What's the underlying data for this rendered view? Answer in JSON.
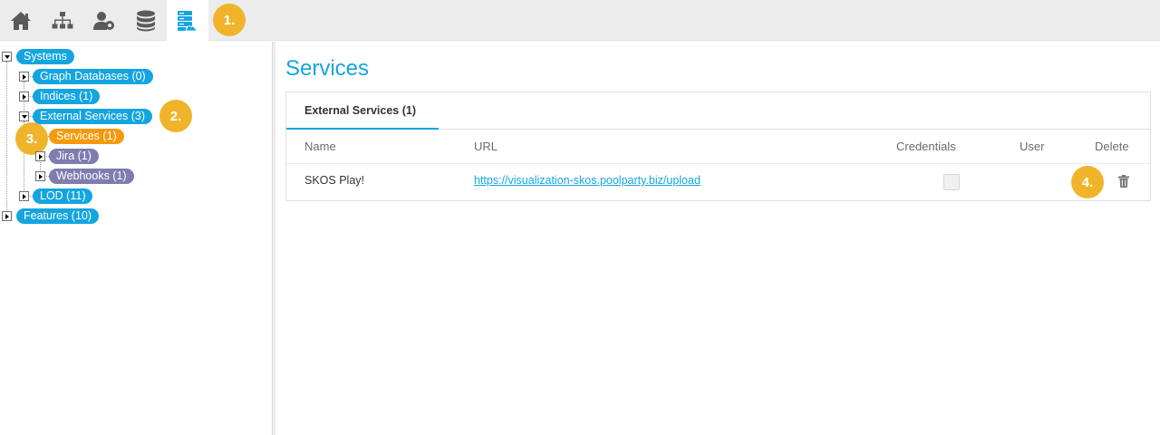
{
  "toolbar": {
    "buttons": [
      {
        "icon": "home-icon"
      },
      {
        "icon": "sitemap-icon"
      },
      {
        "icon": "user-settings-icon"
      },
      {
        "icon": "database-icon"
      },
      {
        "icon": "server-cloud-icon",
        "active": true
      }
    ]
  },
  "callouts": {
    "c1": "1.",
    "c2": "2.",
    "c3": "3.",
    "c4": "4."
  },
  "tree": {
    "systems": "Systems",
    "graph_databases": "Graph Databases (0)",
    "indices": "Indices (1)",
    "external_services": "External Services (3)",
    "services": "Services (1)",
    "jira": "Jira (1)",
    "webhooks": "Webhooks (1)",
    "lod": "LOD (11)",
    "features": "Features (10)"
  },
  "main": {
    "title": "Services",
    "tab_label": "External Services (1)",
    "columns": {
      "name": "Name",
      "url": "URL",
      "credentials": "Credentials",
      "user": "User",
      "delete": "Delete"
    },
    "rows": [
      {
        "name": "SKOS Play!",
        "url": "https://visualization-skos.poolparty.biz/upload",
        "credentials": false,
        "user": ""
      }
    ]
  },
  "colors": {
    "accent": "#14a5e0",
    "orange": "#f59a0f",
    "purple": "#7e7dae",
    "callout": "#f0b42a"
  }
}
